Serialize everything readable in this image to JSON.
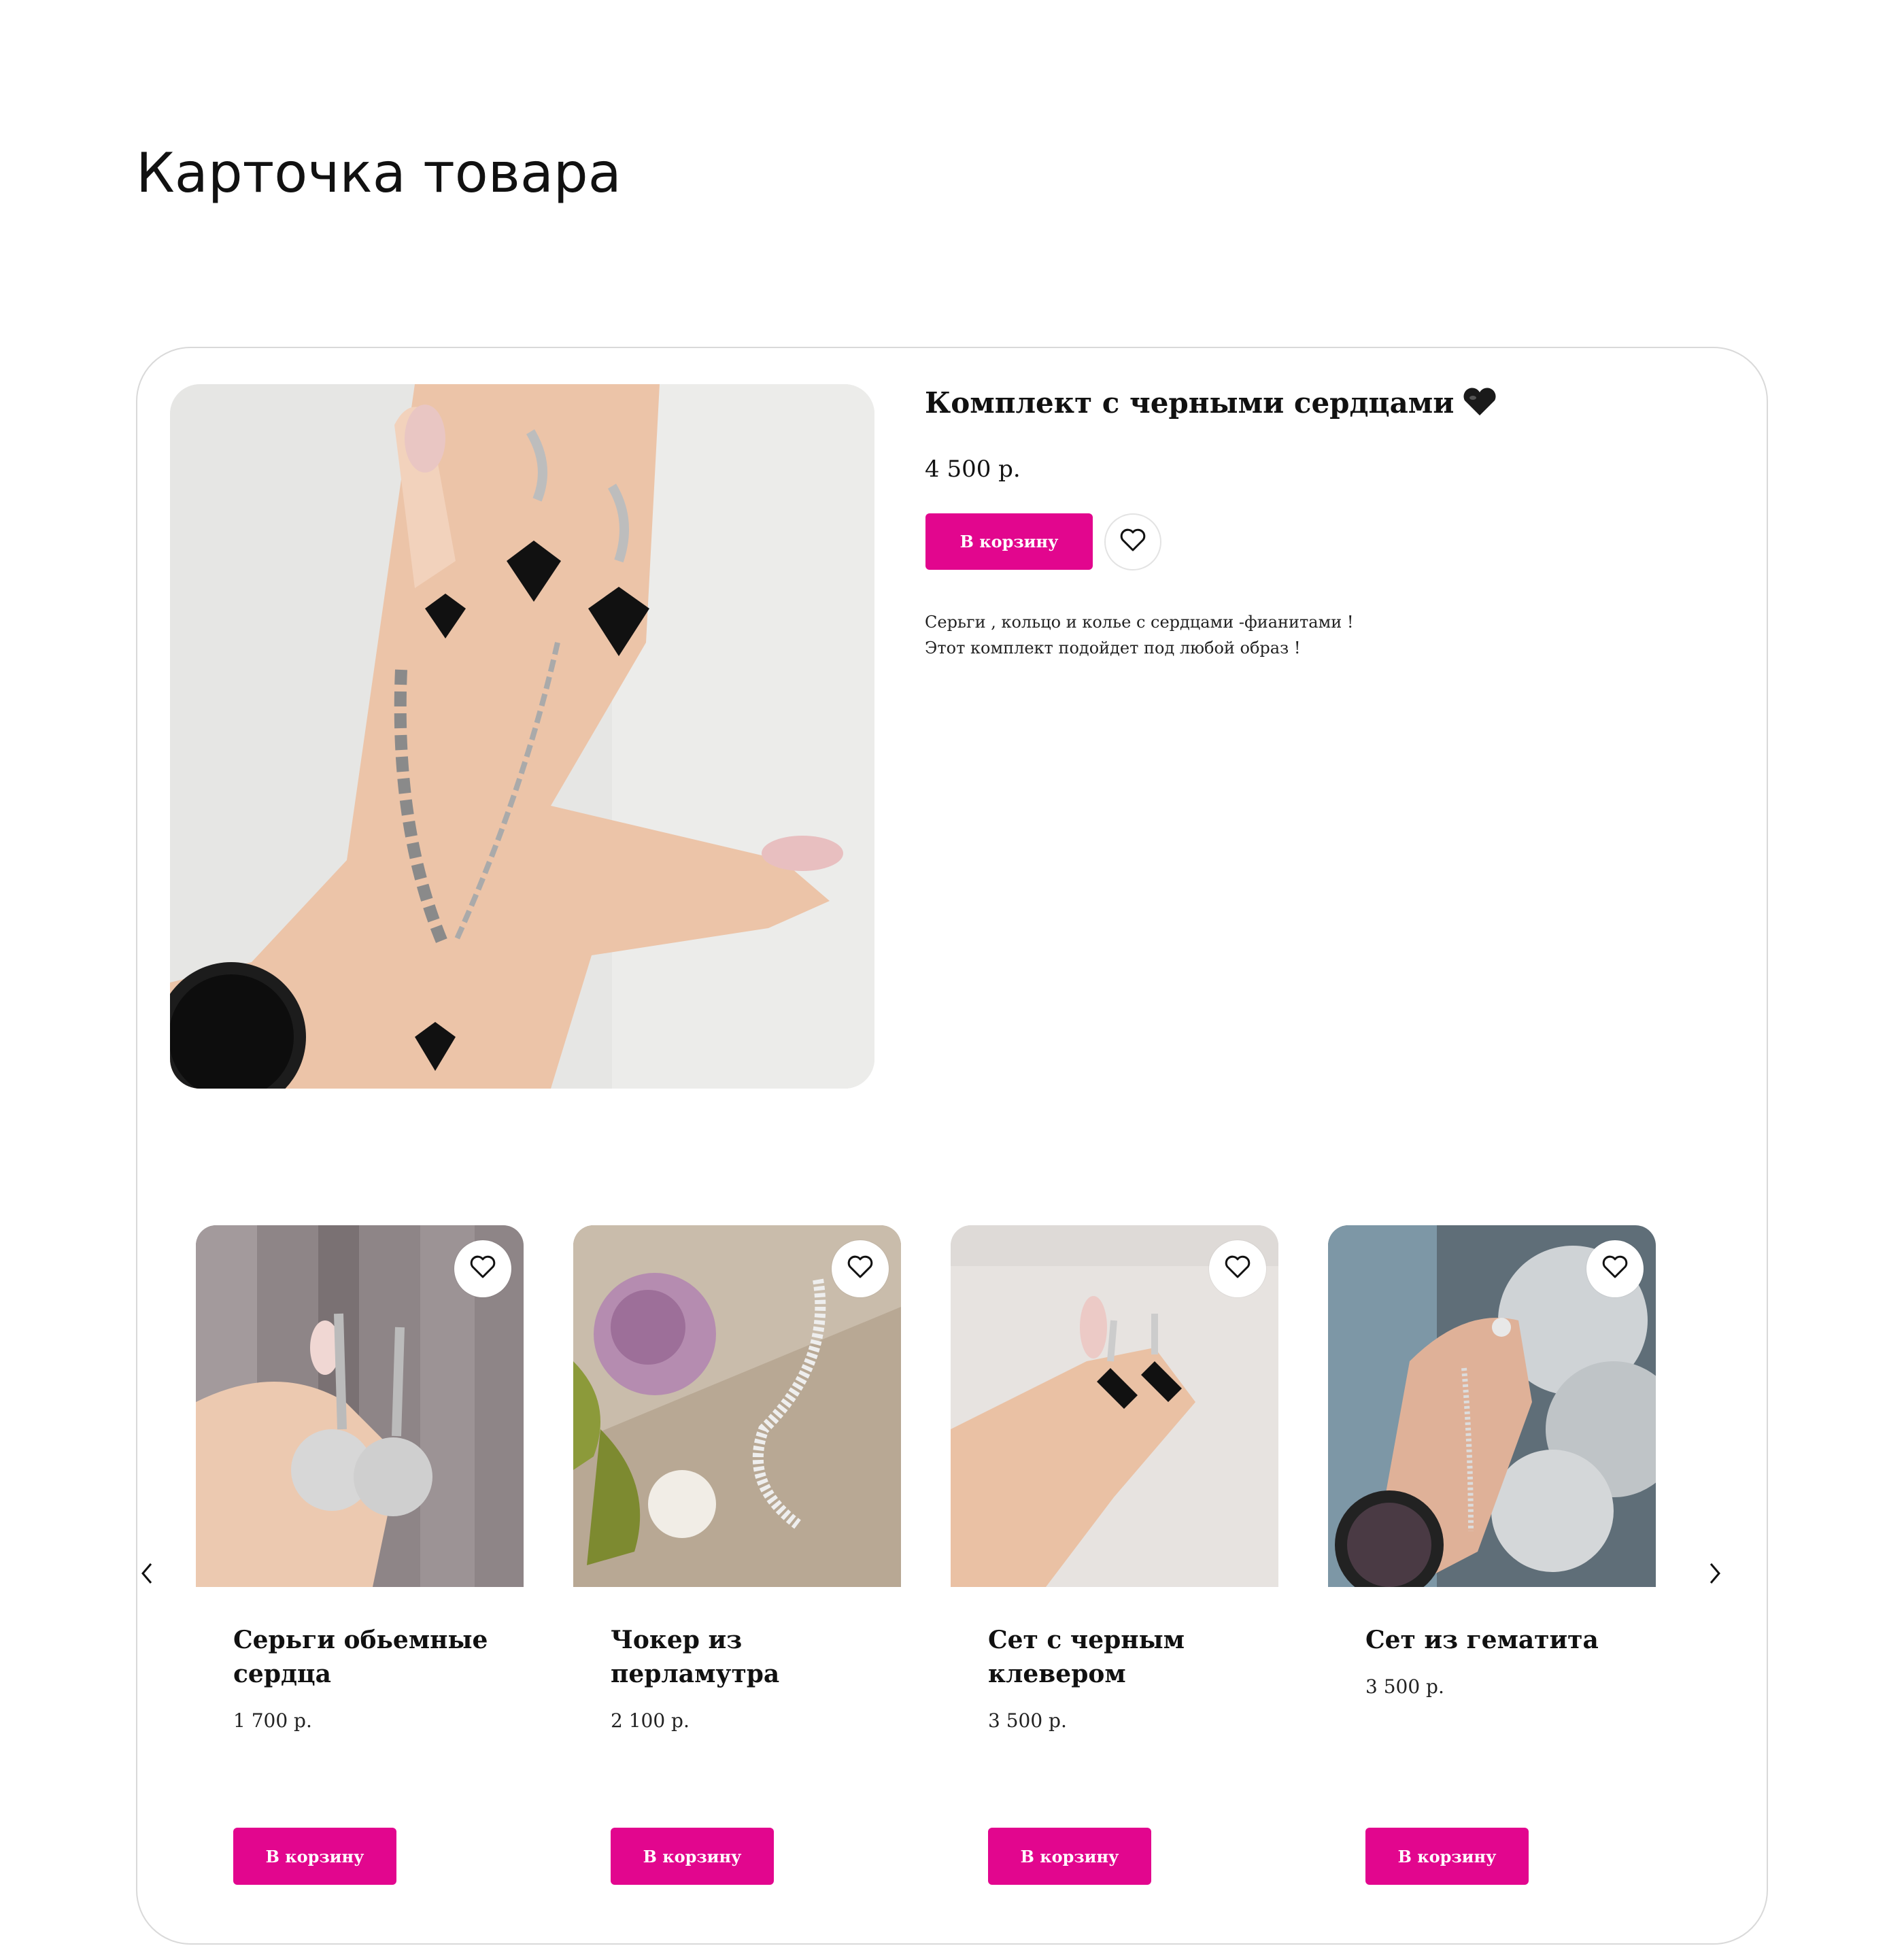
{
  "page": {
    "heading": "Карточка товара"
  },
  "product": {
    "title": "Комплект с черными сердцами",
    "title_emoji_icon": "black-heart-icon",
    "price": "4 500 р.",
    "cart_label": "В корзину",
    "favorite_icon": "heart-outline-icon",
    "description_lines": [
      "Серьги , кольцо и колье с сердцами -фианитами !",
      "Этот комплект подойдет под любой образ !"
    ]
  },
  "related": {
    "prev_icon": "chevron-left-icon",
    "next_icon": "chevron-right-icon",
    "items": [
      {
        "name": "Серьги обьемные сердца",
        "price": "1 700 р.",
        "cart_label": "В корзину"
      },
      {
        "name": "Чокер из перламутра",
        "price": "2 100 р.",
        "cart_label": "В корзину"
      },
      {
        "name": "Сет с черным клевером",
        "price": "3 500 р.",
        "cart_label": "В корзину"
      },
      {
        "name": "Сет из гематита",
        "price": "3 500 р.",
        "cart_label": "В корзину"
      }
    ]
  },
  "colors": {
    "accent": "#e2068e",
    "border": "#d9d9d9"
  }
}
